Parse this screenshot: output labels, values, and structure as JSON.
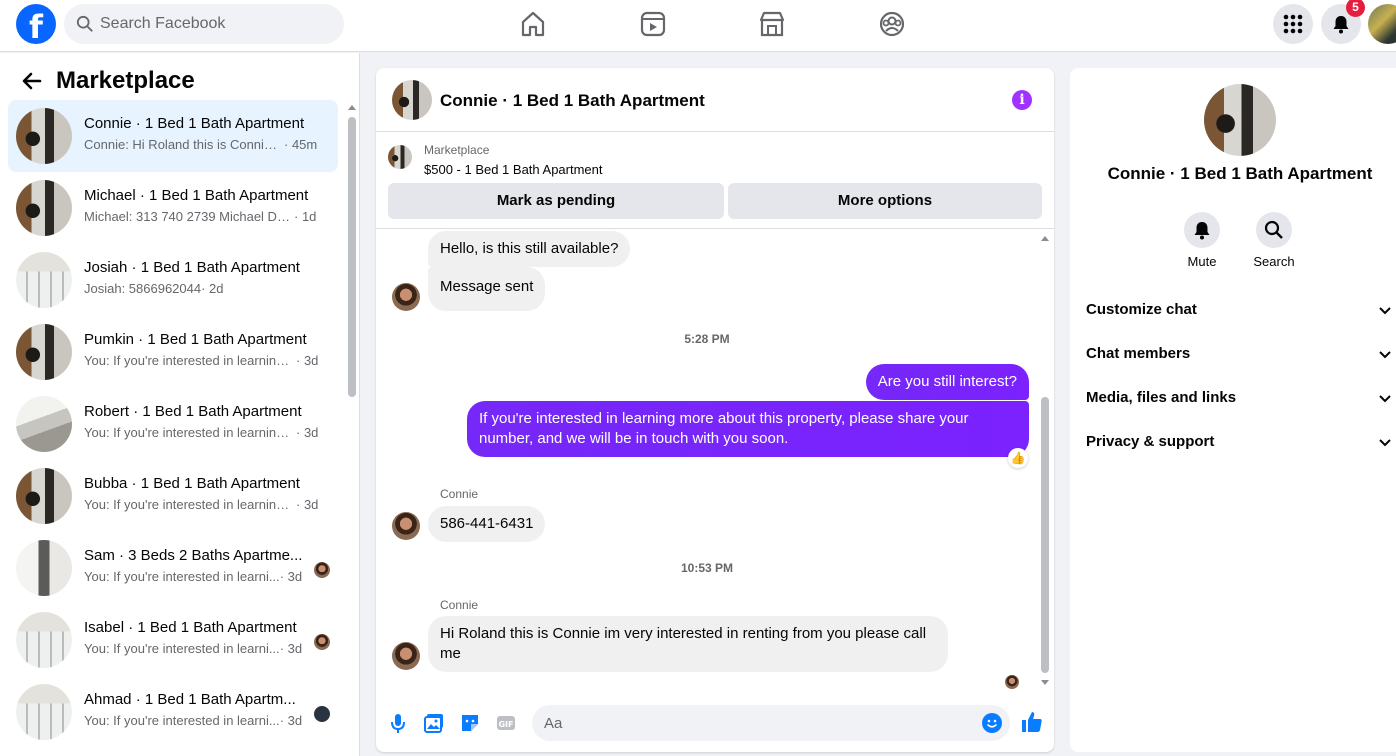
{
  "topbar": {
    "logo": "f",
    "search_placeholder": "Search Facebook",
    "nav_icons": [
      "home-icon",
      "video-icon",
      "marketplace-icon",
      "groups-icon"
    ],
    "notification_count": "5",
    "accent_color": "#0866ff"
  },
  "sidebar": {
    "title": "Marketplace",
    "conversations": [
      {
        "name": "Connie · 1 Bed 1 Bath Apartment",
        "preview": "Connie: Hi Roland this is Connie i...",
        "time": "· 45m",
        "active": true
      },
      {
        "name": "Michael · 1 Bed 1 Bath Apartment",
        "preview": "Michael: 313 740 2739 Michael Dra...",
        "time": "· 1d"
      },
      {
        "name": "Josiah · 1 Bed 1 Bath Apartment",
        "preview": "Josiah: 5866962044",
        "time": "· 2d"
      },
      {
        "name": "Pumkin · 1 Bed 1 Bath Apartment",
        "preview": "You: If you're interested in learning ...",
        "time": "· 3d"
      },
      {
        "name": "Robert · 1 Bed 1 Bath Apartment",
        "preview": "You: If you're interested in learning ...",
        "time": "· 3d"
      },
      {
        "name": "Bubba · 1 Bed 1 Bath Apartment",
        "preview": "You: If you're interested in learning ...",
        "time": "· 3d"
      },
      {
        "name": "Sam · 3 Beds 2 Baths Apartme...",
        "preview": "You: If you're interested in learni...",
        "time": "· 3d"
      },
      {
        "name": "Isabel · 1 Bed 1 Bath Apartment",
        "preview": "You: If you're interested in learni...",
        "time": "· 3d"
      },
      {
        "name": "Ahmad · 1 Bed 1 Bath Apartm...",
        "preview": "You: If you're interested in learni...",
        "time": "· 3d"
      }
    ]
  },
  "chat": {
    "title": "Connie · 1 Bed 1 Bath Apartment",
    "info_icon": "i",
    "listing_source": "Marketplace",
    "listing_title": "$500 - 1 Bed 1 Bath Apartment",
    "mark_pending": "Mark as pending",
    "more_options": "More options",
    "messages": {
      "m1": "Hello, is this still available?",
      "m2": "Message sent",
      "time1": "5:28 PM",
      "m3": "Are you still interest?",
      "m4": "If you're interested in learning more about this property, please share your number, and we will be in touch with you soon.",
      "reaction": "👍",
      "sender1": "Connie",
      "m5": "586-441-6431",
      "time2": "10:53 PM",
      "sender2": "Connie",
      "m6": "Hi Roland this is Connie im very interested in renting from you please call me"
    },
    "composer_placeholder": "Aa",
    "outgoing_color": "#7a1bfe"
  },
  "details": {
    "name": "Connie · 1 Bed 1 Bath Apartment",
    "mute": "Mute",
    "search": "Search",
    "sections": [
      "Customize chat",
      "Chat members",
      "Media, files and links",
      "Privacy & support"
    ]
  }
}
